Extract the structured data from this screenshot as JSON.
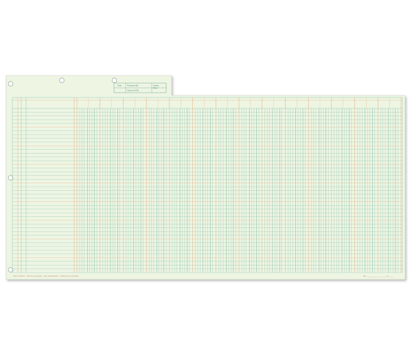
{
  "sheet": {
    "paper_color": "#eef5e3",
    "green_rule_color": "#8ec7b3",
    "dark_green_rule_color": "#4d9a84",
    "orange_rule_color": "#e9b58c",
    "shadow_color": "#b9bcb6",
    "money_columns": 14,
    "rows": 44
  },
  "header_box": {
    "date_label": "Date",
    "prepared_by_label": "Prepared By",
    "approved_by_label": "Approved By",
    "initials_label": "Initials",
    "date_label2": "Date"
  },
  "footer": {
    "left_text": "Form 1234-5 · Forms Company · Item description · www.forms.example",
    "right_text": "No. ____________ ____ of ____"
  }
}
